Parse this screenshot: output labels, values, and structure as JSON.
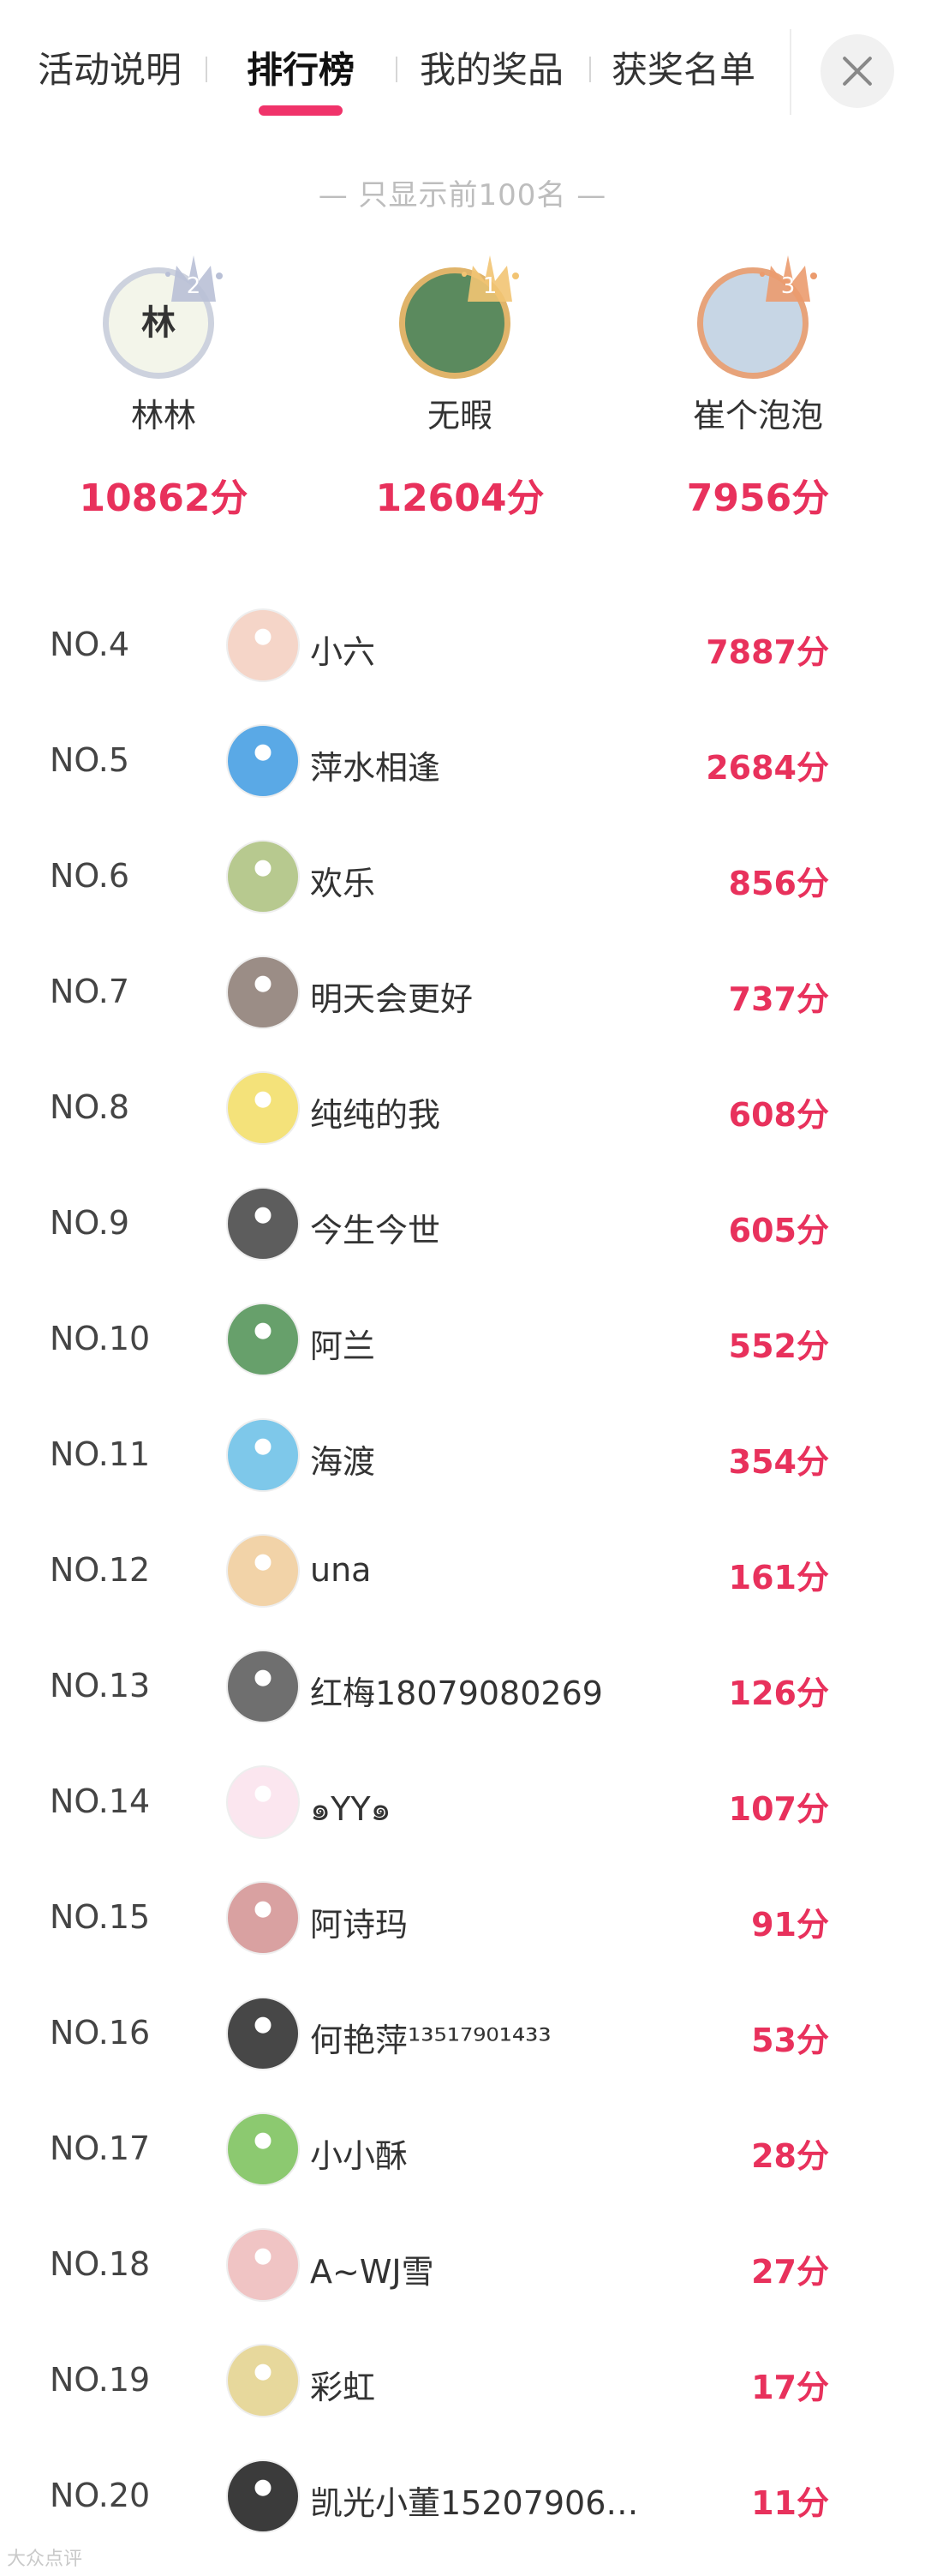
{
  "tabs": {
    "items": [
      "活动说明",
      "排行榜",
      "我的奖品",
      "获奖名单"
    ],
    "active_index": 1
  },
  "notice": "— 只显示前100名 —",
  "podium": [
    {
      "rank_badge": "2",
      "name": "林林",
      "score": "10862分",
      "avatar_text": "林",
      "avatar_color": "#f3f5ea",
      "ring_color": "#cdd2de",
      "crown_color": "#b9c0d6"
    },
    {
      "rank_badge": "1",
      "name": "无暇",
      "score": "12604分",
      "avatar_text": "",
      "avatar_color": "#5b8a5e",
      "ring_color": "#e0b46a",
      "crown_color": "#f2c473"
    },
    {
      "rank_badge": "3",
      "name": "崔个泡泡",
      "score": "7956分",
      "avatar_text": "",
      "avatar_color": "#c7d6e5",
      "ring_color": "#e7a37a",
      "crown_color": "#eb9b6e"
    }
  ],
  "ranking": [
    {
      "rank": "NO.4",
      "name": "小六",
      "score": "7887分",
      "avatar_color": "#f5d5c8"
    },
    {
      "rank": "NO.5",
      "name": "萍水相逢",
      "score": "2684分",
      "avatar_color": "#5aa9e6"
    },
    {
      "rank": "NO.6",
      "name": "欢乐",
      "score": "856分",
      "avatar_color": "#b7c98f"
    },
    {
      "rank": "NO.7",
      "name": "明天会更好",
      "score": "737分",
      "avatar_color": "#9b8d86"
    },
    {
      "rank": "NO.8",
      "name": "纯纯的我",
      "score": "608分",
      "avatar_color": "#f4e27a"
    },
    {
      "rank": "NO.9",
      "name": "今生今世",
      "score": "605分",
      "avatar_color": "#5d5d5d"
    },
    {
      "rank": "NO.10",
      "name": "阿兰",
      "score": "552分",
      "avatar_color": "#67a06b"
    },
    {
      "rank": "NO.11",
      "name": "海渡",
      "score": "354分",
      "avatar_color": "#7ec8ea"
    },
    {
      "rank": "NO.12",
      "name": "una",
      "score": "161分",
      "avatar_color": "#f2d3a8"
    },
    {
      "rank": "NO.13",
      "name": "红梅18079080269",
      "score": "126分",
      "avatar_color": "#6f6f6f"
    },
    {
      "rank": "NO.14",
      "name": "๑YY๑",
      "score": "107分",
      "avatar_color": "#fbe6ef"
    },
    {
      "rank": "NO.15",
      "name": "阿诗玛",
      "score": "91分",
      "avatar_color": "#d9a1a1"
    },
    {
      "rank": "NO.16",
      "name": "何艳萍¹³⁵¹⁷⁹⁰¹⁴³³",
      "score": "53分",
      "avatar_color": "#474747"
    },
    {
      "rank": "NO.17",
      "name": "小小酥",
      "score": "28分",
      "avatar_color": "#8cc970"
    },
    {
      "rank": "NO.18",
      "name": "A~WJ雪",
      "score": "27分",
      "avatar_color": "#f0c4c4"
    },
    {
      "rank": "NO.19",
      "name": "彩虹",
      "score": "17分",
      "avatar_color": "#e7d89c"
    },
    {
      "rank": "NO.20",
      "name": "凯光小董15207906…",
      "score": "11分",
      "avatar_color": "#3b3b3b"
    }
  ],
  "watermark": "大众点评",
  "colors": {
    "accent": "#f0336a",
    "score": "#e8315c"
  }
}
